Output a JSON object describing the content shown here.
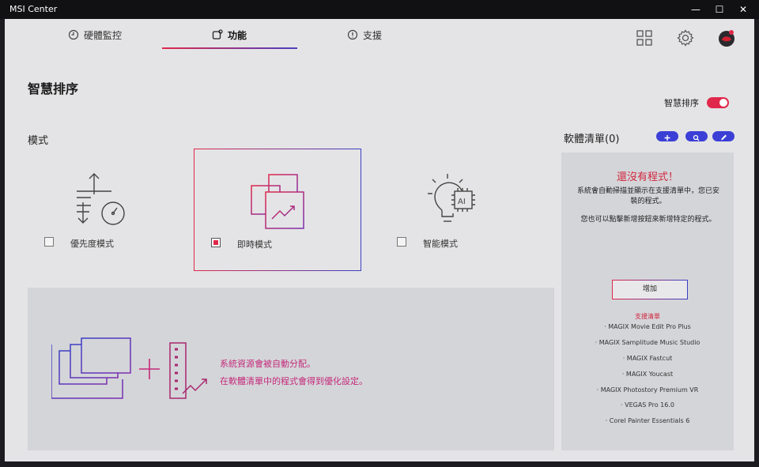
{
  "window": {
    "title": "MSI Center"
  },
  "tabs": [
    {
      "label": "硬體監控"
    },
    {
      "label": "功能"
    },
    {
      "label": "支援"
    }
  ],
  "page": {
    "title": "智慧排序"
  },
  "toggle": {
    "label": "智慧排序",
    "on": true
  },
  "modes": {
    "label": "模式",
    "items": [
      {
        "label": "優先度模式",
        "checked": false
      },
      {
        "label": "即時模式",
        "checked": true
      },
      {
        "label": "智能模式",
        "checked": false
      }
    ]
  },
  "info": {
    "line1": "系統資源會被自動分配。",
    "line2": "在軟體清單中的程式會得到優化設定。"
  },
  "software_list": {
    "title": "軟體清單(0)",
    "empty_title": "還沒有程式！",
    "desc1": "系統會自動掃描並顯示在支援清單中，您已安裝的程式。",
    "desc2": "您也可以點擊新增按鈕來新增特定的程式。",
    "add_label": "增加",
    "supported_title": "支援清單",
    "supported": [
      "· MAGIX Movie Edit Pro Plus",
      "· MAGIX Samplitude Music Studio",
      "· MAGIX Fastcut",
      "· MAGIX Youcast",
      "· MAGIX Photostory Premium VR",
      "· VEGAS Pro 16.0",
      "· Corel Painter Essentials 6"
    ]
  },
  "colors": {
    "accent_red": "#e0284a",
    "accent_blue": "#3b3fd6",
    "accent_purple": "#7a2fb0"
  },
  "icons": [
    "clock-icon",
    "function-icon",
    "support-icon",
    "grid-icon",
    "gear-icon",
    "avatar",
    "minimize-icon",
    "maximize-icon",
    "close-icon",
    "plus-icon",
    "search-icon",
    "edit-icon"
  ]
}
